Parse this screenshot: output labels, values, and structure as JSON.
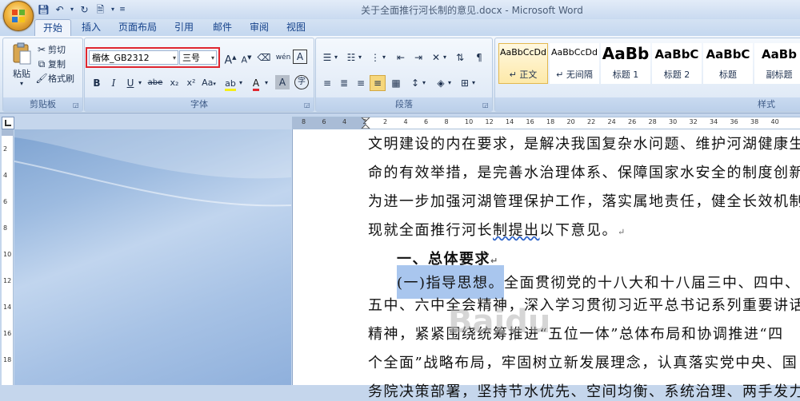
{
  "window": {
    "title": "关于全面推行河长制的意见.docx - Microsoft Word"
  },
  "tabs": [
    "开始",
    "插入",
    "页面布局",
    "引用",
    "邮件",
    "审阅",
    "视图"
  ],
  "active_tab": "开始",
  "clipboard": {
    "paste": "粘贴",
    "cut": "剪切",
    "copy": "复制",
    "format_painter": "格式刷",
    "label": "剪贴板"
  },
  "font": {
    "name": "楷体_GB2312",
    "size": "三号",
    "label": "字体",
    "bold": "B",
    "italic": "I",
    "underline": "U",
    "strike": "abe",
    "subscript": "x₂",
    "superscript": "x²",
    "case": "Aa",
    "grow": "A",
    "shrink": "A",
    "phonetic": "wén",
    "border_char": "A",
    "shade_char": "A",
    "enclose": "字"
  },
  "paragraph": {
    "label": "段落"
  },
  "styles": {
    "label": "样式",
    "items": [
      {
        "sample": "AaBbCcDd",
        "name": "↵ 正文"
      },
      {
        "sample": "AaBbCcDd",
        "name": "↵ 无间隔"
      },
      {
        "sample": "AaBb",
        "name": "标题 1"
      },
      {
        "sample": "AaBbC",
        "name": "标题 2"
      },
      {
        "sample": "AaBbC",
        "name": "标题"
      },
      {
        "sample": "AaBb",
        "name": "副标题"
      }
    ]
  },
  "ruler": {
    "ticks": [
      "8",
      "6",
      "4",
      "2",
      "2",
      "4",
      "6",
      "8",
      "10",
      "12",
      "14",
      "16",
      "18",
      "20",
      "22",
      "24",
      "26",
      "28",
      "30",
      "32",
      "34",
      "36",
      "38",
      "40"
    ],
    "vticks": [
      "2",
      "4",
      "6",
      "8",
      "10",
      "12",
      "14",
      "16",
      "18"
    ]
  },
  "document": {
    "line1": "文明建设的内在要求，是解决我国复杂水问题、维护河湖健康生",
    "line2": "命的有效举措，是完善水治理体系、保障国家水安全的制度创新。",
    "line3": "为进一步加强河湖管理保护工作，落实属地责任，健全长效机制，",
    "line4a": "现就全面推行河长",
    "line4b": "制提出",
    "line4c": "以下意见。",
    "heading": "一、总体要求",
    "sub_selected": "(一)指导思想。",
    "sub_rest": "全面贯彻党的十八大和十八届三中、四中、",
    "line7": "五中、六中全会精神，深入学习贯彻习近平总书记系列重要讲话",
    "line8": "精神，紧紧围绕统筹推进“五位一体”总体布局和协调推进“四",
    "line9": "个全面”战略布局，牢固树立新发展理念，认真落实党中央、国",
    "line10": "务院决策部署，坚持节水优先、空间均衡、系统治理、两手发力，",
    "para_mark": "↵"
  },
  "watermark": "Baidu"
}
